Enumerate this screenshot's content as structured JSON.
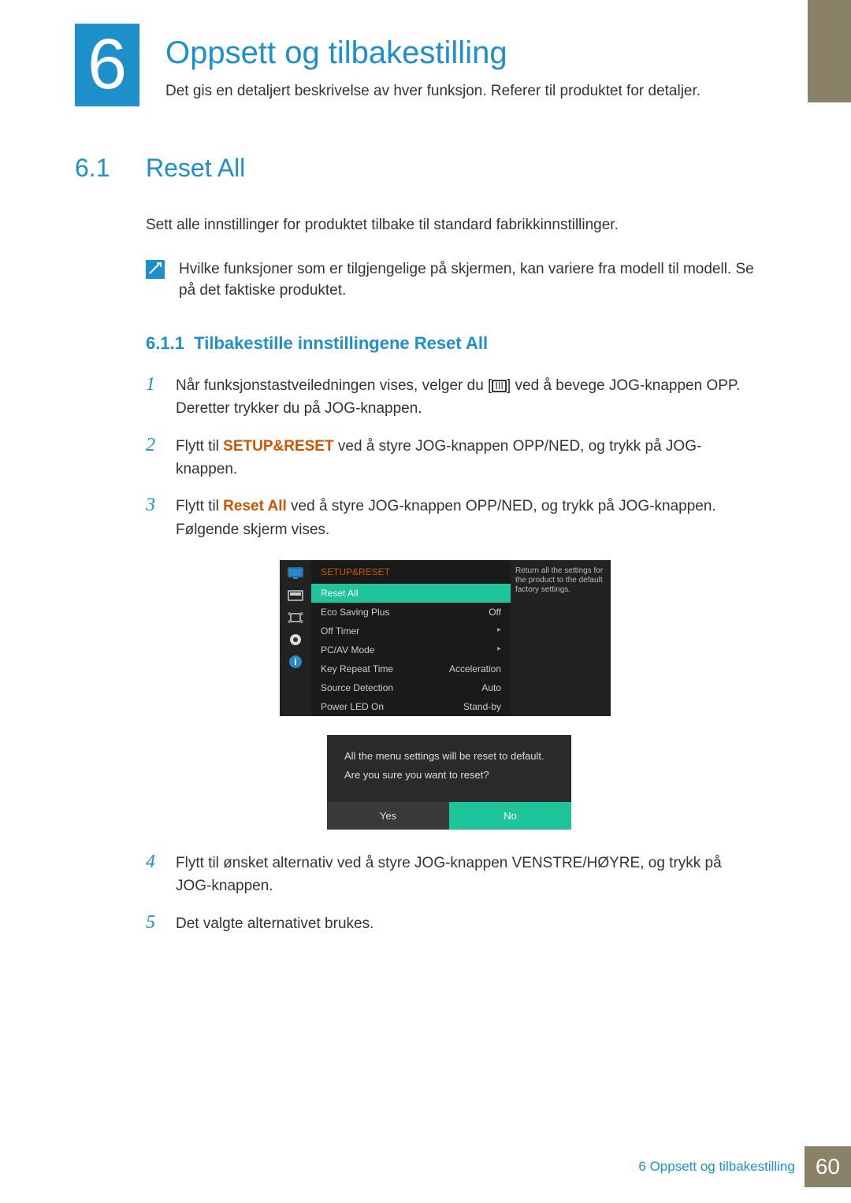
{
  "chapter": {
    "num": "6",
    "title": "Oppsett og tilbakestilling",
    "sub": "Det gis en detaljert beskrivelse av hver funksjon. Referer til produktet for detaljer."
  },
  "section": {
    "num": "6.1",
    "title": "Reset All",
    "intro": "Sett alle innstillinger for produktet tilbake til standard fabrikkinnstillinger."
  },
  "note": "Hvilke funksjoner som er tilgjengelige på skjermen, kan variere fra modell til modell. Se på det faktiske produktet.",
  "sub": {
    "num": "6.1.1",
    "title": "Tilbakestille innstillingene Reset All"
  },
  "steps": {
    "s1a": "Når funksjonstastveiledningen vises, velger du [",
    "s1b": "] ved å bevege JOG-knappen OPP. Deretter trykker du på JOG-knappen.",
    "s2a": "Flytt til ",
    "s2_kw": "SETUP&RESET",
    "s2b": " ved å styre JOG-knappen OPP/NED, og trykk på JOG-knappen.",
    "s3a": "Flytt til ",
    "s3_kw": "Reset All",
    "s3b": " ved å styre JOG-knappen OPP/NED, og trykk på JOG-knappen. Følgende skjerm vises.",
    "s4": "Flytt til ønsket alternativ ved å styre JOG-knappen VENSTRE/HØYRE, og trykk på JOG-knappen.",
    "s5": "Det valgte alternativet brukes.",
    "n1": "1",
    "n2": "2",
    "n3": "3",
    "n4": "4",
    "n5": "5"
  },
  "osd": {
    "header": "SETUP&RESET",
    "tip": "Return all the settings for the product to the default factory settings.",
    "rows": [
      {
        "label": "Reset All",
        "val": ""
      },
      {
        "label": "Eco Saving Plus",
        "val": "Off"
      },
      {
        "label": "Off Timer",
        "val": "▸"
      },
      {
        "label": "PC/AV Mode",
        "val": "▸"
      },
      {
        "label": "Key Repeat Time",
        "val": "Acceleration"
      },
      {
        "label": "Source Detection",
        "val": "Auto"
      },
      {
        "label": "Power LED On",
        "val": "Stand-by"
      }
    ]
  },
  "dialog": {
    "line1": "All the menu settings will be reset to default.",
    "line2": "Are you sure you want to reset?",
    "yes": "Yes",
    "no": "No"
  },
  "footer": {
    "text": "6 Oppsett og tilbakestilling",
    "page": "60"
  }
}
